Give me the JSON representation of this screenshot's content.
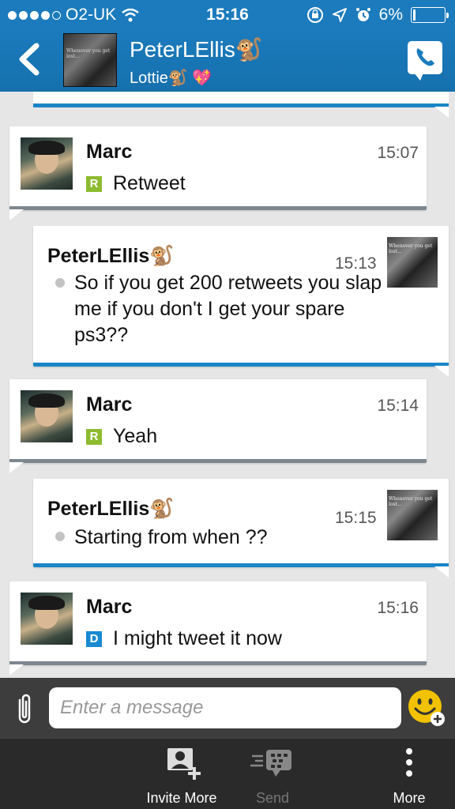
{
  "status_bar": {
    "carrier": "O2-UK",
    "time": "15:16",
    "battery": "6%",
    "battery_level": 0.06
  },
  "header": {
    "contact_name": "PeterLEllis🐒",
    "contact_status": "Lottie🐒 💖",
    "avatar_caption": "Whenever you get lost..."
  },
  "messages": [
    {
      "direction": "in",
      "sender": "Marc",
      "time": "15:07",
      "badge": "R",
      "text": "Retweet"
    },
    {
      "direction": "out",
      "sender": "PeterLEllis🐒",
      "time": "15:13",
      "text": "So if you get 200 retweets you slap me if you don't I get your spare ps3??"
    },
    {
      "direction": "in",
      "sender": "Marc",
      "time": "15:14",
      "badge": "R",
      "text": "Yeah"
    },
    {
      "direction": "out",
      "sender": "PeterLEllis🐒",
      "time": "15:15",
      "text": "Starting from when ??"
    },
    {
      "direction": "in",
      "sender": "Marc",
      "time": "15:16",
      "badge": "D",
      "text": "I might tweet it now"
    }
  ],
  "composer": {
    "placeholder": "Enter a message"
  },
  "toolbar": {
    "invite_label": "Invite More",
    "send_label": "Send",
    "more_label": "More"
  },
  "colors": {
    "header_blue": "#1b7bbd",
    "outgoing_accent": "#1a85c6",
    "incoming_accent": "#7d8790",
    "read_badge": "#8dbb2f",
    "delivered_badge": "#1a8ad0"
  }
}
